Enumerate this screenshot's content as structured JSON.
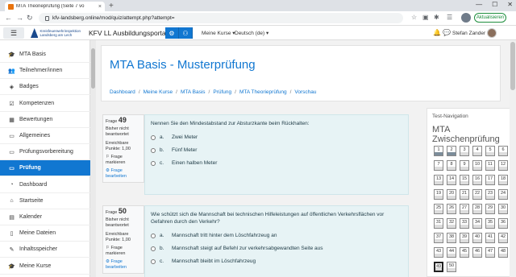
{
  "browser": {
    "tab_title": "MTA Theorieprüfung (Seite 7 vo",
    "tab_close": "×",
    "new_tab": "+",
    "win_min": "—",
    "win_max": "☐",
    "win_close": "✕",
    "url": "kfv-landsberg.online/mod/quiz/attempt.php?attempt=",
    "update_label": "Aktualisieren"
  },
  "moodle": {
    "logo_line1": "Kreisfeuerwehrinspektion",
    "logo_line2": "Landsberg am Lech",
    "site_name": "KFV LL Ausbildungsportal",
    "my_courses": "Meine Kurse ▾",
    "language": "Deutsch (de) ▾",
    "user_name": "Stefan Zander ▾"
  },
  "sidebar": {
    "items": [
      {
        "label": "MTA Basis",
        "icon": "graduation-cap-icon",
        "glyph": "🎓"
      },
      {
        "label": "Teilnehmer/innen",
        "icon": "users-icon",
        "glyph": "👥"
      },
      {
        "label": "Badges",
        "icon": "shield-icon",
        "glyph": "◈"
      },
      {
        "label": "Kompetenzen",
        "icon": "check-square-icon",
        "glyph": "☑"
      },
      {
        "label": "Bewertungen",
        "icon": "table-icon",
        "glyph": "▦"
      },
      {
        "label": "Allgemeines",
        "icon": "folder-icon",
        "glyph": "▭"
      },
      {
        "label": "Prüfungsvorbereitung",
        "icon": "folder-icon",
        "glyph": "▭"
      },
      {
        "label": "Prüfung",
        "icon": "folder-icon",
        "glyph": "▭"
      },
      {
        "label": "Dashboard",
        "icon": "dashboard-icon",
        "glyph": "◔"
      },
      {
        "label": "Startseite",
        "icon": "home-icon",
        "glyph": "⌂"
      },
      {
        "label": "Kalender",
        "icon": "calendar-icon",
        "glyph": "▤"
      },
      {
        "label": "Meine Dateien",
        "icon": "file-icon",
        "glyph": "▯"
      },
      {
        "label": "Inhaltsspeicher",
        "icon": "paint-brush-icon",
        "glyph": "✎"
      },
      {
        "label": "Meine Kurse",
        "icon": "graduation-cap-icon",
        "glyph": "🎓"
      }
    ]
  },
  "page": {
    "title": "MTA Basis - Musterprüfung",
    "breadcrumb": [
      "Dashboard",
      "Meine Kurse",
      "MTA Basis",
      "Prüfung",
      "MTA Theorieprüfung",
      "Vorschau"
    ]
  },
  "questions": [
    {
      "number": "49",
      "prefix": "Frage ",
      "status": "Bisher nicht beantwortet",
      "points": "Erreichbare Punkte: 1,00",
      "flag": "Frage markieren",
      "edit": "Frage bearbeiten",
      "text": "Nennen Sie den Mindestabstand zur Absturzkante beim Rückhalten:",
      "options": [
        {
          "letter": "a.",
          "text": "Zwei Meter"
        },
        {
          "letter": "b.",
          "text": "Fünf Meter"
        },
        {
          "letter": "c.",
          "text": "Einen halben Meter"
        }
      ]
    },
    {
      "number": "50",
      "prefix": "Frage ",
      "status": "Bisher nicht beantwortet",
      "points": "Erreichbare Punkte: 1,00",
      "flag": "Frage markieren",
      "edit": "Frage bearbeiten",
      "text": "Wie schützt sich die Mannschaft bei technischen Hilfeleistungen auf öffentlichen Verkehrsflächen vor Gefahren durch den Verkehr?",
      "options": [
        {
          "letter": "a.",
          "text": "Mannschaft tritt hinter dem Löschfahrzeug an"
        },
        {
          "letter": "b.",
          "text": "Mannschaft steigt auf Befehl zur verkehrsabgewandten Seite aus"
        },
        {
          "letter": "c.",
          "text": "Mannschaft bleibt im Löschfahrzeug"
        }
      ]
    }
  ],
  "quiz_nav": {
    "heading": "Test-Navigation",
    "subtitle": "MTA Zwischenprüfung",
    "numbers": [
      "1",
      "2",
      "3",
      "4",
      "5",
      "6",
      "7",
      "8",
      "9",
      "10",
      "11",
      "12",
      "13",
      "14",
      "15",
      "16",
      "17",
      "18",
      "19",
      "20",
      "21",
      "22",
      "23",
      "24",
      "25",
      "26",
      "27",
      "28",
      "29",
      "30",
      "31",
      "32",
      "33",
      "34",
      "35",
      "36",
      "37",
      "38",
      "39",
      "40",
      "41",
      "42",
      "43",
      "44",
      "45",
      "46",
      "47",
      "48",
      "49",
      "50"
    ],
    "answered": [
      "1",
      "2"
    ],
    "current": "49"
  }
}
